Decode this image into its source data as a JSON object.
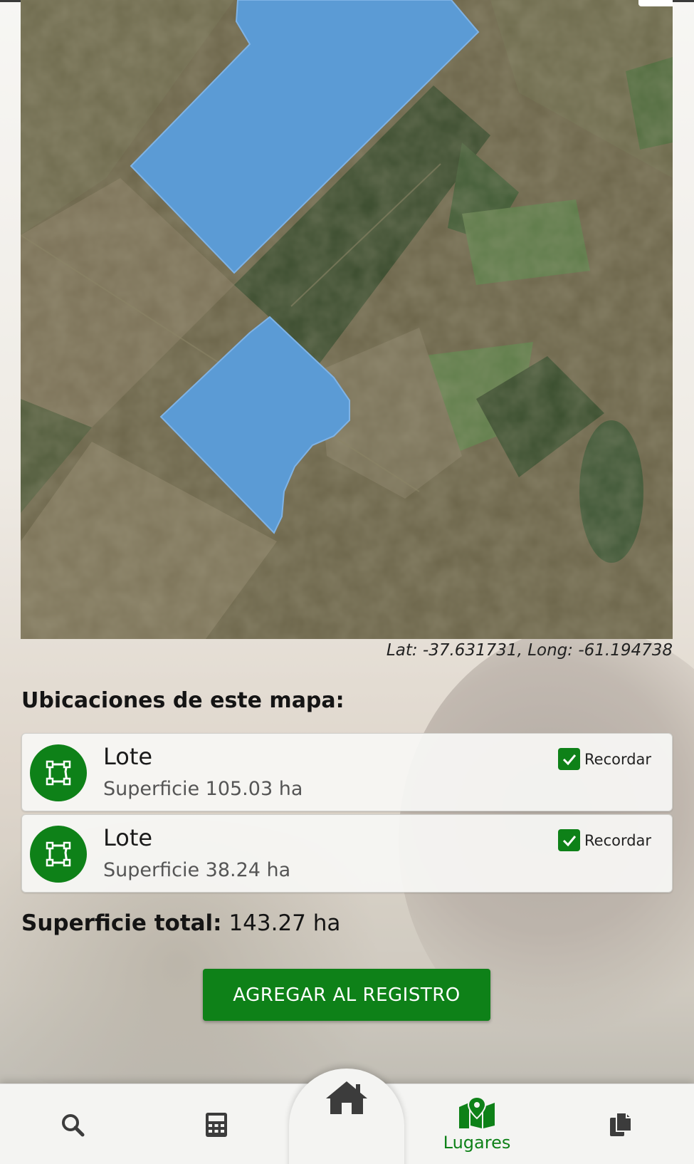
{
  "map": {
    "coords_text": "Lat: -37.631731, Long: -61.194738"
  },
  "section_title": "Ubicaciones de este mapa:",
  "locations": [
    {
      "title": "Lote",
      "area": "Superficie 105.03 ha",
      "remember_label": "Recordar",
      "remember_checked": true
    },
    {
      "title": "Lote",
      "area": "Superficie 38.24 ha",
      "remember_label": "Recordar",
      "remember_checked": true
    }
  ],
  "total": {
    "label": "Superficie total:",
    "value": "143.27 ha"
  },
  "add_button": {
    "label": "AGREGAR AL REGISTRO"
  },
  "nav": {
    "items": [
      {
        "icon": "search-icon",
        "label": ""
      },
      {
        "icon": "calculator-icon",
        "label": ""
      },
      {
        "icon": "home-icon",
        "label": ""
      },
      {
        "icon": "map-marker-icon",
        "label": "Lugares",
        "active": true
      },
      {
        "icon": "documents-icon",
        "label": ""
      }
    ]
  },
  "colors": {
    "accent": "#0e8118",
    "polygon": "#5b9bd5",
    "inactive_icon": "#3c3c3c"
  }
}
